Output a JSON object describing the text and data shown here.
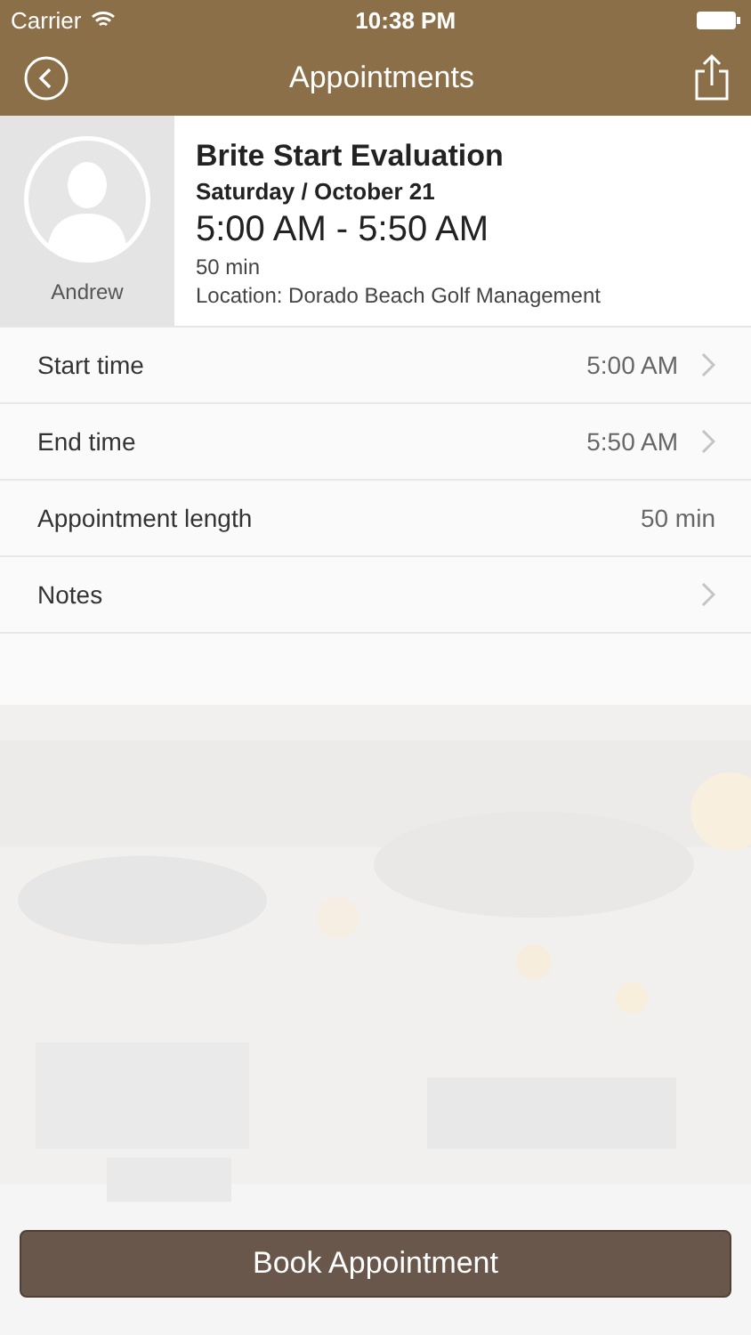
{
  "status_bar": {
    "carrier": "Carrier",
    "time": "10:38 PM"
  },
  "nav_bar": {
    "title": "Appointments"
  },
  "appointment": {
    "client_name": "Andrew",
    "title": "Brite Start Evaluation",
    "date": "Saturday / October 21",
    "time_range": "5:00 AM - 5:50 AM",
    "duration": "50 min",
    "location": "Location: Dorado Beach Golf Management"
  },
  "rows": [
    {
      "kind": "link",
      "label": "Start time",
      "value": "5:00 AM"
    },
    {
      "kind": "link",
      "label": "End time",
      "value": "5:50 AM"
    },
    {
      "kind": "static",
      "label": "Appointment length",
      "value": "50 min"
    },
    {
      "kind": "link",
      "label": "Notes"
    }
  ],
  "book_button": {
    "label": "Book Appointment"
  }
}
